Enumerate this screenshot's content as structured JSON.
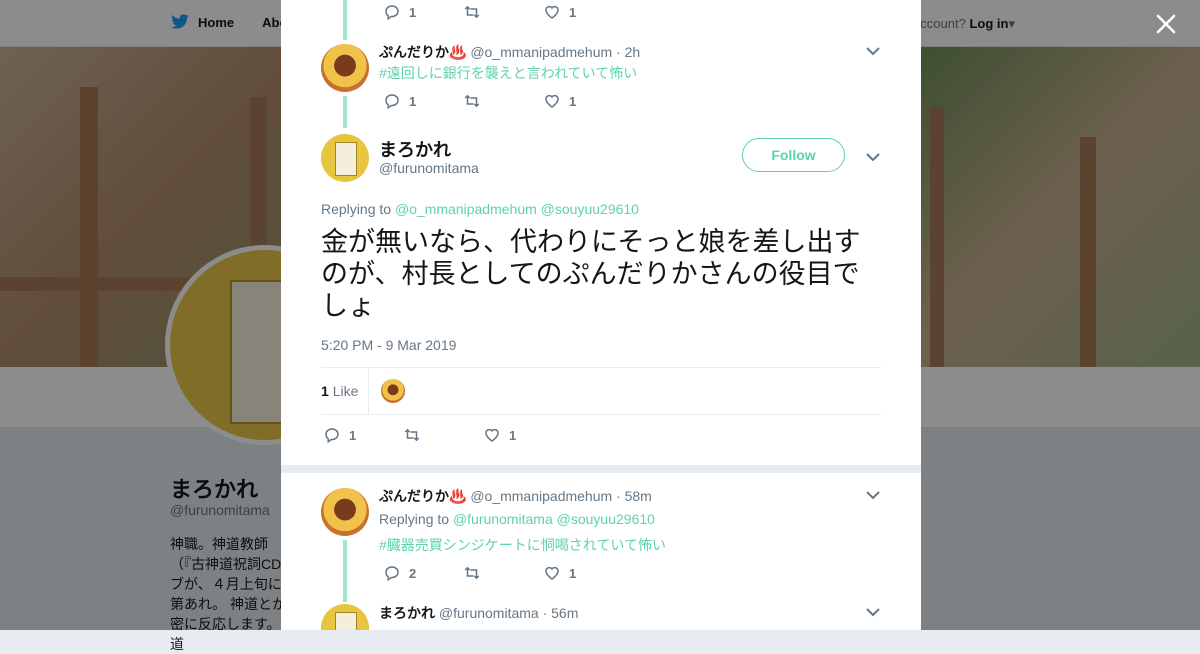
{
  "topbar": {
    "home": "Home",
    "about": "Abo",
    "login_prefix": "ccount?",
    "login": "Log in"
  },
  "profile": {
    "name": "まろかれ",
    "handle": "@furunomitama",
    "bio": "神職。神道教師（『古神道祝詞CDブが、４月上旬に第あれ。 神道とか密に反応します。道"
  },
  "tweets": [
    {
      "actions": {
        "reply": "1",
        "retweet": "",
        "like": "1"
      }
    },
    {
      "name": "ぷんだりか♨️",
      "handle": "@o_mmanipadmehum",
      "time": "· 2h",
      "text": "#遠回しに銀行を襲えと言われていて怖い",
      "actions": {
        "reply": "1",
        "retweet": "",
        "like": "1"
      }
    }
  ],
  "main": {
    "name": "まろかれ",
    "handle": "@furunomitama",
    "follow": "Follow",
    "replying_prefix": "Replying to",
    "replying_1": "@o_mmanipadmehum",
    "replying_2": "@souyuu29610",
    "text": "金が無いなら、代わりにそっと娘を差し出すのが、村長としてのぷんだりかさんの役目でしょ",
    "timestamp": "5:20 PM - 9 Mar 2019",
    "like_count": "1",
    "like_label": "Like",
    "actions": {
      "reply": "1",
      "retweet": "",
      "like": "1"
    }
  },
  "replies": [
    {
      "name": "ぷんだりか♨️",
      "handle": "@o_mmanipadmehum",
      "time": "· 58m",
      "replying_prefix": "Replying to",
      "replying_1": "@furunomitama",
      "replying_2": "@souyuu29610",
      "text": "#臓器売買シンジケートに恫喝されていて怖い",
      "actions": {
        "reply": "2",
        "retweet": "",
        "like": "1"
      }
    },
    {
      "name": "まろかれ",
      "handle": "@furunomitama",
      "time": "· 56m",
      "text": ""
    }
  ],
  "colors": {
    "accent": "#5ed3a6",
    "text": "#14171a",
    "muted": "#657786"
  }
}
